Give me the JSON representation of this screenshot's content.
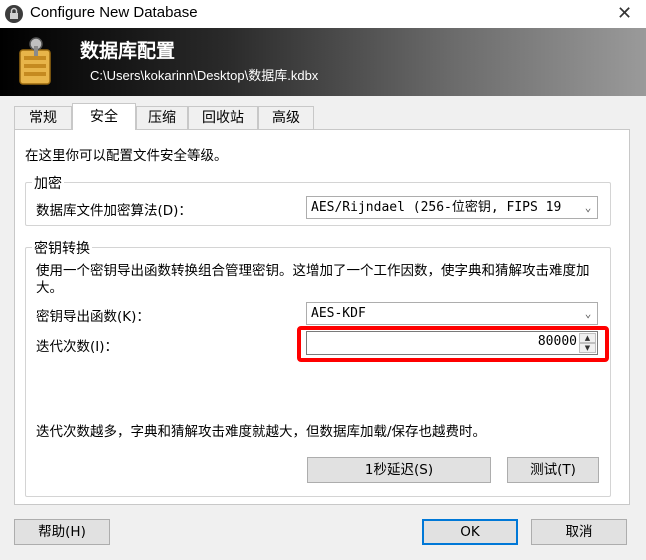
{
  "window": {
    "title": "Configure New Database",
    "close_glyph": "✕"
  },
  "banner": {
    "title": "数据库配置",
    "path": "C:\\Users\\kokarinn\\Desktop\\数据库.kdbx"
  },
  "tabs": [
    {
      "label": "常规"
    },
    {
      "label": "安全"
    },
    {
      "label": "压缩"
    },
    {
      "label": "回收站"
    },
    {
      "label": "高级"
    }
  ],
  "active_tab": "安全",
  "security": {
    "intro": "在这里你可以配置文件安全等级。",
    "encryption": {
      "legend": "加密",
      "algorithm_label": "数据库文件加密算法(D)：",
      "algorithm_value": "AES/Rijndael (256-位密钥, FIPS 19"
    },
    "key_transform": {
      "legend": "密钥转换",
      "description": "使用一个密钥导出函数转换组合管理密钥。这增加了一个工作因数，使字典和猜解攻击难度加大。",
      "kdf_label": "密钥导出函数(K)：",
      "kdf_value": "AES-KDF",
      "iterations_label": "迭代次数(I)：",
      "iterations_value": "80000",
      "hint": "迭代次数越多，字典和猜解攻击难度就越大，但数据库加载/保存也越费时。",
      "delay_button": "1秒延迟(S)",
      "test_button": "测试(T)"
    }
  },
  "footer": {
    "help_button": "帮助(H)",
    "ok_button": "OK",
    "cancel_button": "取消"
  },
  "icons": {
    "window": "lock-icon",
    "banner": "database-config-icon",
    "dropdown": "chevron-down-icon",
    "spin": "spin-arrows-icon"
  },
  "colors": {
    "highlight": "#ff0000",
    "default_button_border": "#0078d7"
  }
}
